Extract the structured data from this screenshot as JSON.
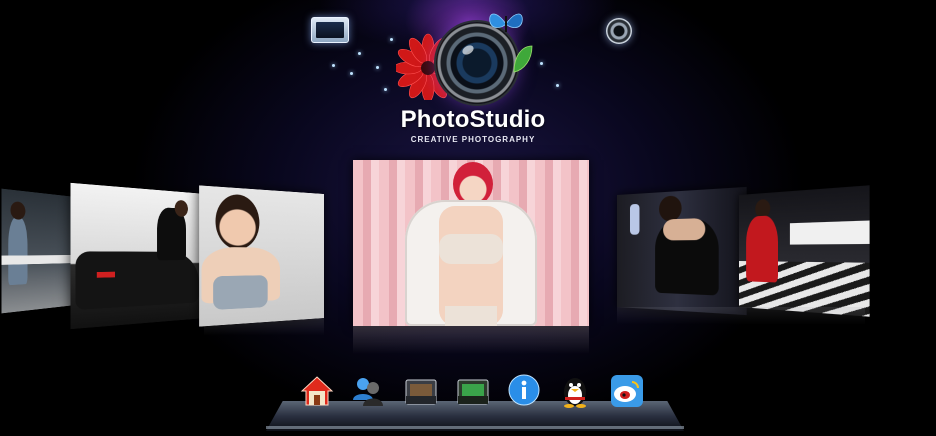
{
  "brand": {
    "title": "PhotoStudio",
    "subtitle": "CREATIVE PHOTOGRAPHY"
  },
  "header": {
    "left_icon": "monitor-icon",
    "right_icon": "speaker-icon"
  },
  "carousel": {
    "photos": [
      {
        "id": "left-3",
        "icon": "photo-thumbnail"
      },
      {
        "id": "left-2",
        "icon": "photo-thumbnail"
      },
      {
        "id": "left-1",
        "icon": "photo-thumbnail"
      },
      {
        "id": "center",
        "icon": "photo-featured"
      },
      {
        "id": "right-1",
        "icon": "photo-thumbnail"
      },
      {
        "id": "right-2",
        "icon": "photo-thumbnail"
      }
    ]
  },
  "dock": {
    "items": [
      {
        "name": "home",
        "icon": "home-icon"
      },
      {
        "name": "users",
        "icon": "users-icon"
      },
      {
        "name": "gallery-dark",
        "icon": "photo-folder-icon"
      },
      {
        "name": "gallery-green",
        "icon": "photo-folder-green-icon"
      },
      {
        "name": "info",
        "icon": "info-icon"
      },
      {
        "name": "qq",
        "icon": "qq-penguin-icon"
      },
      {
        "name": "weibo",
        "icon": "weibo-icon"
      }
    ]
  },
  "colors": {
    "background": "#000000",
    "accent_purple": "#a040d2",
    "brand_text": "#ffffff"
  }
}
